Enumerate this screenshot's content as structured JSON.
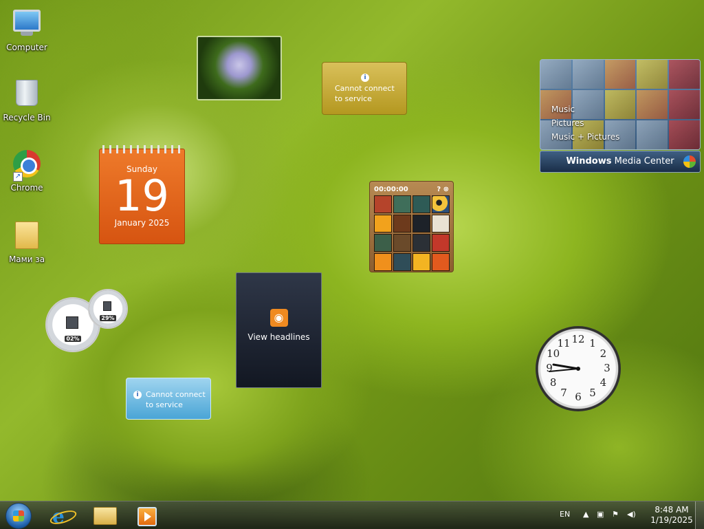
{
  "desktop_icons": [
    {
      "label": "Computer",
      "icon": "computer-icon"
    },
    {
      "label": "Recycle Bin",
      "icon": "recycle-bin-icon"
    },
    {
      "label": "Chrome",
      "icon": "chrome-icon"
    },
    {
      "label": "Мами за",
      "icon": "folder-icon"
    }
  ],
  "weather_top": {
    "message": "Cannot connect to service"
  },
  "weather_bottom": {
    "message": "Cannot connect to service"
  },
  "calendar": {
    "weekday": "Sunday",
    "day": "19",
    "month_year": "January 2025"
  },
  "puzzle": {
    "timer": "00:00:00",
    "help": "?",
    "close": "⊗"
  },
  "feed": {
    "label": "View headlines"
  },
  "cpu_meter": {
    "cpu": "02%",
    "memory": "29%"
  },
  "media_center": {
    "menu": [
      "Music",
      "Pictures",
      "Music + Pictures"
    ],
    "brand_bold": "Windows",
    "brand_rest": " Media Center"
  },
  "clock_face": [
    "12",
    "1",
    "2",
    "3",
    "4",
    "5",
    "6",
    "7",
    "8",
    "9",
    "10",
    "11"
  ],
  "taskbar": {
    "language": "EN",
    "time": "8:48 AM",
    "date": "1/19/2025"
  }
}
